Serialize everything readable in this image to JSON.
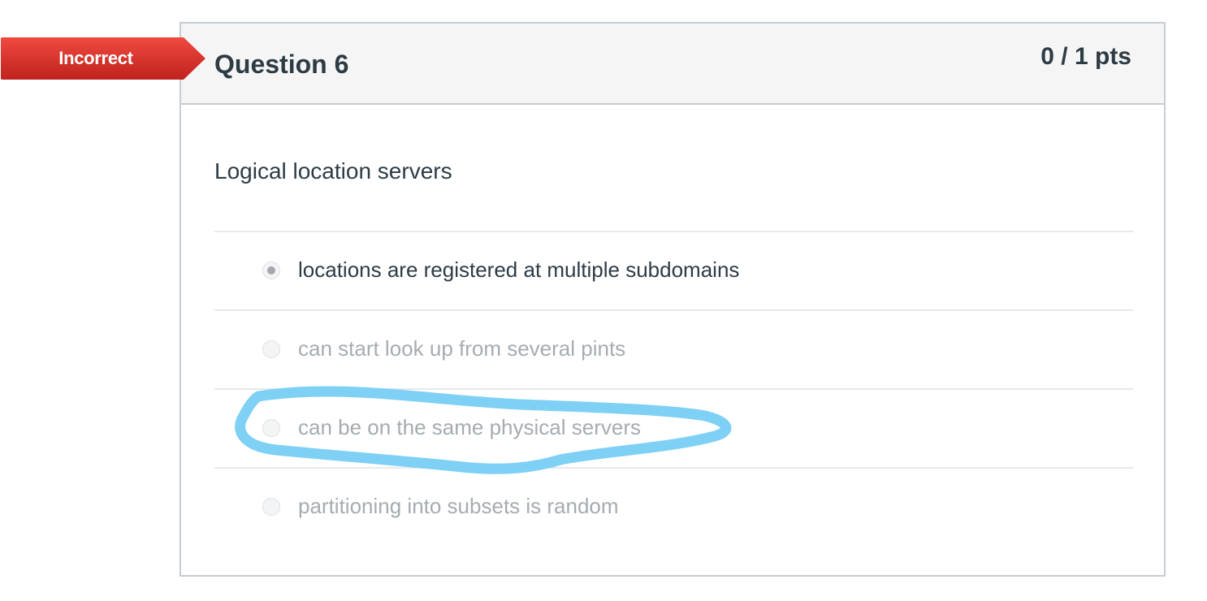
{
  "flag": {
    "label": "Incorrect",
    "color": "#d9322b"
  },
  "question": {
    "title": "Question 6",
    "points": "0 / 1 pts",
    "text": "Logical location servers"
  },
  "answers": [
    {
      "label": "locations are registered at multiple subdomains",
      "selected": true
    },
    {
      "label": "can start look up from several pints",
      "selected": false
    },
    {
      "label": "can be on the same physical servers",
      "selected": false
    },
    {
      "label": "partitioning into subsets is random",
      "selected": false
    }
  ],
  "annotation": {
    "color": "#7fd0f5",
    "icon": "hand-drawn-circle-icon"
  }
}
